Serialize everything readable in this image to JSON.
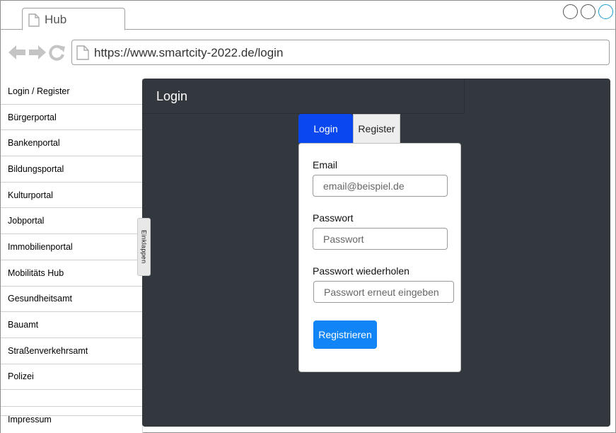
{
  "browser": {
    "tab_title": "Hub",
    "url": "https://www.smartcity-2022.de/login",
    "icons": [
      "page-icon",
      "back-arrow-icon",
      "forward-arrow-icon",
      "reload-icon",
      "window-circle-icon"
    ],
    "accent_color": "#1e9ad6"
  },
  "sidebar": {
    "items": [
      {
        "label": "Login / Register"
      },
      {
        "label": "Bürgerportal"
      },
      {
        "label": "Bankenportal"
      },
      {
        "label": "Bildungsportal"
      },
      {
        "label": "Kulturportal"
      },
      {
        "label": "Jobportal"
      },
      {
        "label": "Immobilienportal"
      },
      {
        "label": "Mobilitäts Hub"
      },
      {
        "label": "Gesundheitsamt"
      },
      {
        "label": "Bauamt"
      },
      {
        "label": "Straßenverkehrsamt"
      },
      {
        "label": "Polizei"
      }
    ],
    "footer_label": "Impressum",
    "collapse_label": "Einklappen"
  },
  "main": {
    "title": "Login",
    "background": "#33383f",
    "tabs": {
      "login": "Login",
      "register": "Register"
    },
    "form": {
      "email_label": "Email",
      "email_placeholder": "email@beispiel.de",
      "password_label": "Passwort",
      "password_placeholder": "Passwort",
      "password_repeat_label": "Passwort wiederholen",
      "password_repeat_placeholder": "Passwort erneut eingeben",
      "submit_label": "Registrieren",
      "submit_color": "#1185f5",
      "active_tab_color": "#0a47ee"
    }
  }
}
